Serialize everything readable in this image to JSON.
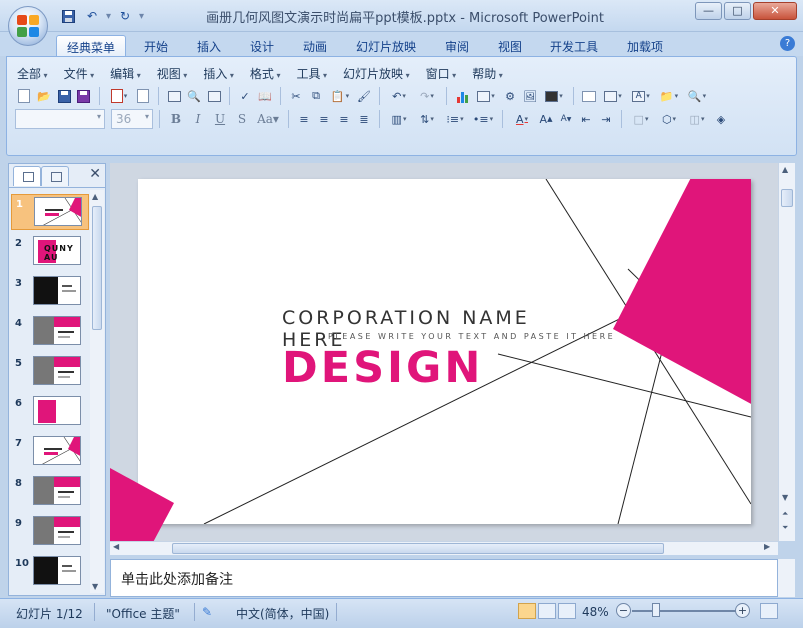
{
  "window": {
    "title": "画册几何风图文演示时尚扁平ppt模板.pptx - Microsoft PowerPoint",
    "controls": {
      "minimize": "—",
      "maximize": "□",
      "close": "✕"
    }
  },
  "ribbon_tabs": [
    "经典菜单",
    "开始",
    "插入",
    "设计",
    "动画",
    "幻灯片放映",
    "审阅",
    "视图",
    "开发工具",
    "加载项"
  ],
  "classic_menus": [
    "全部",
    "文件",
    "编辑",
    "视图",
    "插入",
    "格式",
    "工具",
    "幻灯片放映",
    "窗口",
    "帮助"
  ],
  "toolbar": {
    "font_name": "",
    "font_size": "36"
  },
  "help": "?",
  "slides_panel": {
    "close": "✕",
    "thumbnails": [
      {
        "num": "1",
        "variant": "title"
      },
      {
        "num": "2",
        "variant": "pink"
      },
      {
        "num": "3",
        "variant": "dark"
      },
      {
        "num": "4",
        "variant": "photo"
      },
      {
        "num": "5",
        "variant": "photo"
      },
      {
        "num": "6",
        "variant": "pink"
      },
      {
        "num": "7",
        "variant": "title"
      },
      {
        "num": "8",
        "variant": "photo"
      },
      {
        "num": "9",
        "variant": "photo"
      },
      {
        "num": "10",
        "variant": "dark"
      }
    ],
    "thumb2_text": "QUNY AU"
  },
  "slide": {
    "corp_line": "CORPORATION NAME",
    "here_line": "HERE",
    "subtitle": "PLEASE WRITE YOUR TEXT AND PASTE IT HERE",
    "headline": "DESIGN",
    "accent_color": "#e0157a"
  },
  "notes_placeholder": "单击此处添加备注",
  "status": {
    "slide_counter": "幻灯片 1/12",
    "theme": "\"Office 主题\"",
    "language": "中文(简体，中国)",
    "zoom": "48%",
    "zoom_out": "−",
    "zoom_in": "+"
  }
}
